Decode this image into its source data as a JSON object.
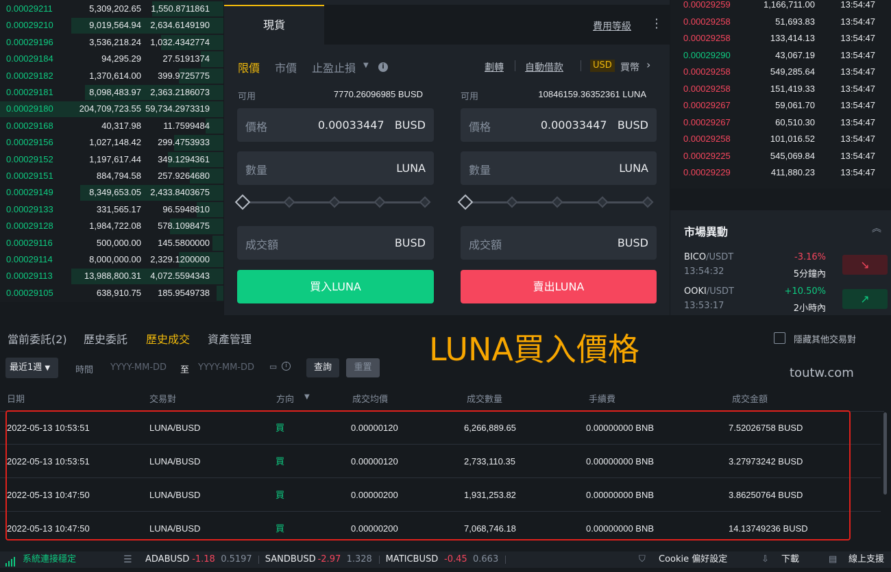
{
  "orderbook": [
    {
      "price": "0.00029211",
      "amount": "5,309,202.65",
      "total": "1,550.8711861",
      "bar": 0.32
    },
    {
      "price": "0.00029210",
      "amount": "9,019,564.94",
      "total": "2,634.6149190",
      "bar": 0.68
    },
    {
      "price": "0.00029196",
      "amount": "3,536,218.24",
      "total": "1,032.4342774",
      "bar": 0.28
    },
    {
      "price": "0.00029184",
      "amount": "94,295.29",
      "total": "27.5191374",
      "bar": 0.1
    },
    {
      "price": "0.00029182",
      "amount": "1,370,614.00",
      "total": "399.9725775",
      "bar": 0.2
    },
    {
      "price": "0.00029181",
      "amount": "8,098,483.97",
      "total": "2,363.2186073",
      "bar": 0.62
    },
    {
      "price": "0.00029180",
      "amount": "204,709,723.55",
      "total": "59,734.2973319",
      "bar": 1.0
    },
    {
      "price": "0.00029168",
      "amount": "40,317.98",
      "total": "11.7599484",
      "bar": 0.08
    },
    {
      "price": "0.00029156",
      "amount": "1,027,148.42",
      "total": "299.4753933",
      "bar": 0.22
    },
    {
      "price": "0.00029152",
      "amount": "1,197,617.44",
      "total": "349.1294361",
      "bar": 0.25
    },
    {
      "price": "0.00029151",
      "amount": "884,794.58",
      "total": "257.9264680",
      "bar": 0.15
    },
    {
      "price": "0.00029149",
      "amount": "8,349,653.05",
      "total": "2,433.8403675",
      "bar": 0.64
    },
    {
      "price": "0.00029133",
      "amount": "331,565.17",
      "total": "96.5948810",
      "bar": 0.12
    },
    {
      "price": "0.00029128",
      "amount": "1,984,722.08",
      "total": "578.1098475",
      "bar": 0.24
    },
    {
      "price": "0.00029116",
      "amount": "500,000.00",
      "total": "145.5800000",
      "bar": 0.05
    },
    {
      "price": "0.00029114",
      "amount": "8,000,000.00",
      "total": "2,329.1200000",
      "bar": 0.2
    },
    {
      "price": "0.00029113",
      "amount": "13,988,800.31",
      "total": "4,072.5594343",
      "bar": 0.68
    },
    {
      "price": "0.00029105",
      "amount": "638,910.75",
      "total": "185.9549738",
      "bar": 0.03
    }
  ],
  "form": {
    "tab_spot": "現貨",
    "fee_level": "費用等級",
    "more": "⋮",
    "type_limit": "限價",
    "type_market": "市價",
    "type_stop": "止盈止損",
    "info": "i",
    "transfer": "劃轉",
    "auto_borrow": "自動借款",
    "usd_badge": "USD",
    "buy_coin": "買幣",
    "avail_label": "可用",
    "buy_avail": "7770.26096985 BUSD",
    "sell_avail": "10846159.36352361 LUNA",
    "price_label": "價格",
    "price_value": "0.00033447",
    "busd": "BUSD",
    "luna": "LUNA",
    "qty_label": "數量",
    "total_label": "成交額",
    "buy_btn": "買入LUNA",
    "sell_btn": "賣出LUNA"
  },
  "trades": [
    {
      "price": "0.00029259",
      "amount": "1,166,711.00",
      "time": "13:54:47",
      "side": "sell"
    },
    {
      "price": "0.00029258",
      "amount": "51,693.83",
      "time": "13:54:47",
      "side": "sell"
    },
    {
      "price": "0.00029258",
      "amount": "133,414.13",
      "time": "13:54:47",
      "side": "sell"
    },
    {
      "price": "0.00029290",
      "amount": "43,067.19",
      "time": "13:54:47",
      "side": "buy"
    },
    {
      "price": "0.00029258",
      "amount": "549,285.64",
      "time": "13:54:47",
      "side": "sell"
    },
    {
      "price": "0.00029258",
      "amount": "151,419.33",
      "time": "13:54:47",
      "side": "sell"
    },
    {
      "price": "0.00029267",
      "amount": "59,061.70",
      "time": "13:54:47",
      "side": "sell"
    },
    {
      "price": "0.00029267",
      "amount": "60,510.30",
      "time": "13:54:47",
      "side": "sell"
    },
    {
      "price": "0.00029258",
      "amount": "101,016.52",
      "time": "13:54:47",
      "side": "sell"
    },
    {
      "price": "0.00029225",
      "amount": "545,069.84",
      "time": "13:54:47",
      "side": "sell"
    },
    {
      "price": "0.00029229",
      "amount": "411,880.23",
      "time": "13:54:47",
      "side": "sell"
    }
  ],
  "market": {
    "title": "市場異動",
    "items": [
      {
        "base": "BICO",
        "quote": "/USDT",
        "time": "13:54:32",
        "change": "-3.16%",
        "period": "5分鐘內",
        "dir": "down"
      },
      {
        "base": "OOKI",
        "quote": "/USDT",
        "time": "13:53:17",
        "change": "+10.50%",
        "period": "2小時內",
        "dir": "up"
      }
    ]
  },
  "bottom": {
    "tabs": [
      "當前委託(2)",
      "歷史委託",
      "歷史成交",
      "資產管理"
    ],
    "overlay": "LUNA買入價格",
    "watermark": "toutw.com",
    "hide_others": "隱藏其他交易對",
    "range": "最近1週",
    "time_label": "時間",
    "date_ph": "YYYY-MM-DD",
    "to": "至",
    "query": "查詢",
    "reset": "重置",
    "headers": [
      "日期",
      "交易對",
      "方向",
      "成交均價",
      "成交數量",
      "手續費",
      "成交金額"
    ],
    "rows": [
      {
        "date": "2022-05-13 10:53:51",
        "pair": "LUNA/BUSD",
        "side": "買",
        "price": "0.00000120",
        "qty": "6,266,889.65",
        "fee": "0.00000000 BNB",
        "total": "7.52026758 BUSD"
      },
      {
        "date": "2022-05-13 10:53:51",
        "pair": "LUNA/BUSD",
        "side": "買",
        "price": "0.00000120",
        "qty": "2,733,110.35",
        "fee": "0.00000000 BNB",
        "total": "3.27973242 BUSD"
      },
      {
        "date": "2022-05-13 10:47:50",
        "pair": "LUNA/BUSD",
        "side": "買",
        "price": "0.00000200",
        "qty": "1,931,253.82",
        "fee": "0.00000000 BNB",
        "total": "3.86250764 BUSD"
      },
      {
        "date": "2022-05-13 10:47:50",
        "pair": "LUNA/BUSD",
        "side": "買",
        "price": "0.00000200",
        "qty": "7,068,746.18",
        "fee": "0.00000000 BNB",
        "total": "14.13749236 BUSD"
      }
    ]
  },
  "status": {
    "conn": "系統連接穩定",
    "tickers": [
      {
        "sym": "ADABUSD",
        "chg": "-1.18",
        "price": "0.5197"
      },
      {
        "sym": "SANDBUSD",
        "chg": "-2.97",
        "price": "1.328"
      },
      {
        "sym": "MATICBUSD",
        "chg": "-0.45",
        "price": "0.663"
      }
    ],
    "cookie": "Cookie 偏好設定",
    "download": "下載",
    "support": "線上支援"
  },
  "colors": {
    "green": "#0ecb81",
    "red": "#f6465d",
    "yellow": "#f0b90b",
    "orange_overlay": "#f7a600"
  }
}
